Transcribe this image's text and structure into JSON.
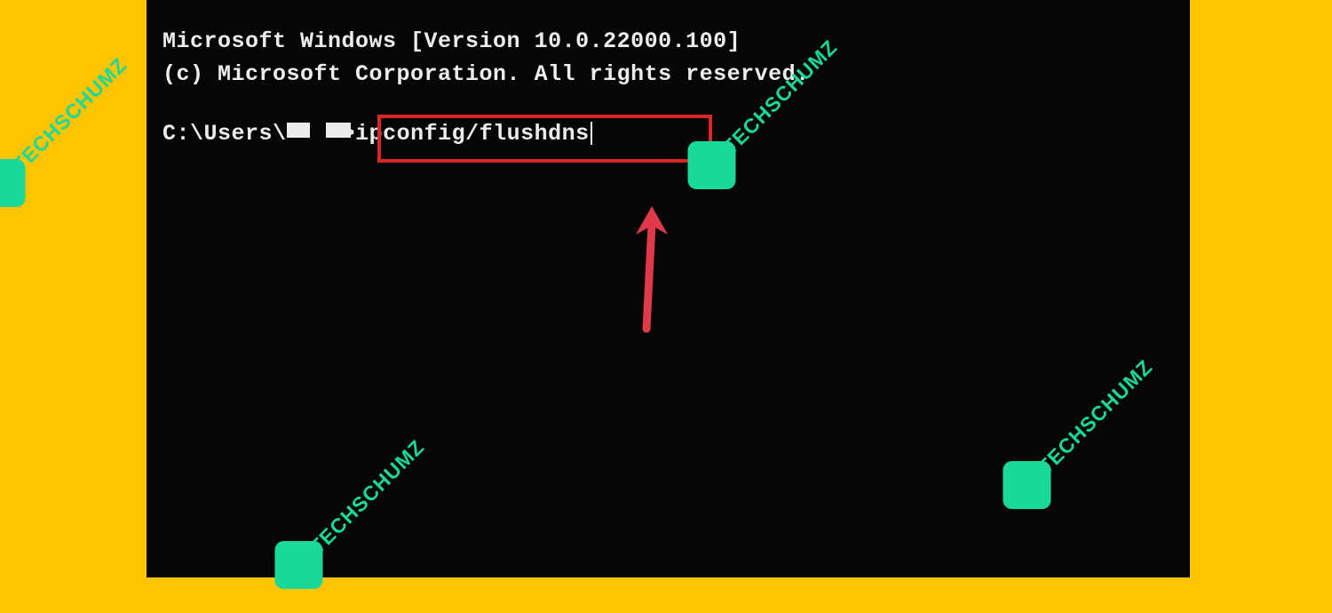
{
  "terminal": {
    "header_line1": "Microsoft Windows [Version 10.0.22000.100]",
    "header_line2": "(c) Microsoft Corporation. All rights reserved.",
    "prompt_prefix": "C:\\Users\\",
    "prompt_user_redacted": "█  █",
    "prompt_separator": ">",
    "command": "ipconfig/flushdns"
  },
  "watermark": {
    "text": "TECHSCHUMZ"
  },
  "annotation": {
    "highlight_color": "#dc2626",
    "arrow_color": "#e0394a"
  }
}
